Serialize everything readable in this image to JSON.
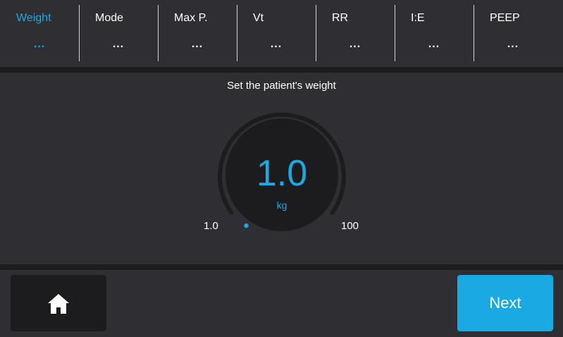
{
  "tabs": [
    {
      "label": "Weight",
      "value": "...",
      "active": true
    },
    {
      "label": "Mode",
      "value": "..."
    },
    {
      "label": "Max P.",
      "value": "..."
    },
    {
      "label": "Vt",
      "value": "..."
    },
    {
      "label": "RR",
      "value": "..."
    },
    {
      "label": "I:E",
      "value": "..."
    },
    {
      "label": "PEEP",
      "value": "..."
    }
  ],
  "prompt": "Set the patient's weight",
  "dial": {
    "value": "1.0",
    "unit": "kg",
    "min_label": "1.0",
    "max_label": "100",
    "level": 0
  },
  "footer": {
    "home_icon": "home-icon",
    "next_label": "Next"
  },
  "colors": {
    "accent": "#19a9e3",
    "panel": "#2f2f33",
    "background": "#1d1d1f",
    "dial_face": "#1c1c1e"
  }
}
